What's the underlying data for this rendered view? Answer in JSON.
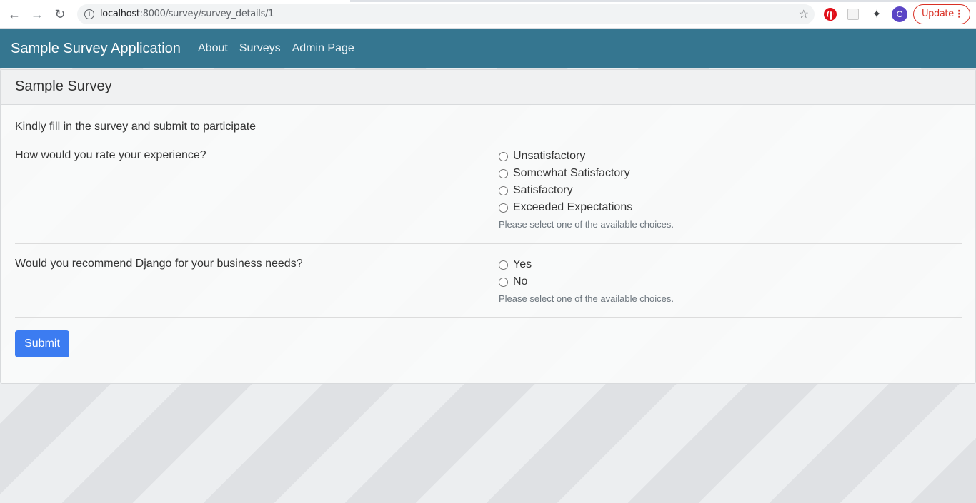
{
  "browser": {
    "url_host": "localhost",
    "url_path": ":8000/survey/survey_details/1",
    "update_label": "Update",
    "profile_initial": "C"
  },
  "navbar": {
    "brand": "Sample Survey Application",
    "links": [
      "About",
      "Surveys",
      "Admin Page"
    ]
  },
  "card": {
    "title": "Sample Survey",
    "intro": "Kindly fill in the survey and submit to participate",
    "questions": [
      {
        "text": "How would you rate your experience?",
        "choices": [
          "Unsatisfactory",
          "Somewhat Satisfactory",
          "Satisfactory",
          "Exceeded Expectations"
        ],
        "help": "Please select one of the available choices."
      },
      {
        "text": "Would you recommend Django for your business needs?",
        "choices": [
          "Yes",
          "No"
        ],
        "help": "Please select one of the available choices."
      }
    ],
    "submit_label": "Submit"
  },
  "colors": {
    "navbar": "#357690",
    "submit": "#3c7cf1",
    "update": "#d93025"
  }
}
